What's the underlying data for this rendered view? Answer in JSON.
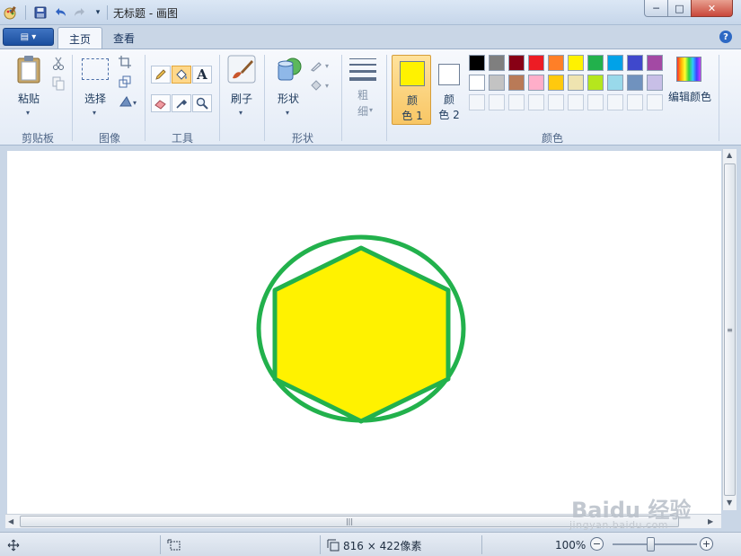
{
  "window": {
    "title": "无标题 - 画图",
    "minimize": "─",
    "maximize": "□",
    "close": "✕"
  },
  "quick_access": {
    "app_icon": "paint-app-icon",
    "save_icon": "save-icon",
    "undo_icon": "undo-icon",
    "redo_icon": "redo-icon",
    "customize_icon": "dropdown-icon"
  },
  "ribbon_tabs": {
    "menu_button": "▤ ▾",
    "home": "主页",
    "view": "查看",
    "help": "?"
  },
  "clipboard": {
    "paste": "粘贴",
    "group": "剪贴板"
  },
  "image": {
    "select": "选择",
    "group": "图像"
  },
  "tools": {
    "group": "工具",
    "text_tool": "A"
  },
  "brushes": {
    "label": "刷子"
  },
  "shapes": {
    "label": "形状",
    "group": "形状"
  },
  "size": {
    "line1": "粗",
    "line2": "细"
  },
  "colors": {
    "color1_line1": "颜",
    "color1_line2": "色 1",
    "color2_line1": "颜",
    "color2_line2": "色 2",
    "edit_colors": "编辑颜色",
    "group": "颜色",
    "color1_value": "#fff200",
    "color2_value": "#ffffff",
    "palette_row1": [
      "#000000",
      "#7f7f7f",
      "#880015",
      "#ed1c24",
      "#ff7f27",
      "#fff200",
      "#22b14c",
      "#00a2e8",
      "#3f48cc",
      "#a349a4"
    ],
    "palette_row2": [
      "#ffffff",
      "#c3c3c3",
      "#b97a57",
      "#ffaec9",
      "#ffc90e",
      "#efe4b0",
      "#b5e61d",
      "#99d9ea",
      "#7092be",
      "#c8bfe7"
    ]
  },
  "drawing": {
    "circle_stroke": "#22b14c",
    "hexagon_fill": "#fff200",
    "hexagon_stroke": "#22b14c"
  },
  "statusbar": {
    "canvas_size": "816 × 422像素",
    "zoom": "100%",
    "zoom_out": "−",
    "zoom_in": "+"
  },
  "watermark": {
    "brand": "Baidu 经验",
    "url": "jingyan.baidu.com"
  }
}
